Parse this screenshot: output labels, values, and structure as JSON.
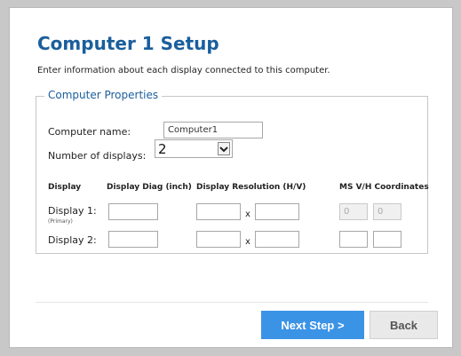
{
  "page": {
    "title": "Computer 1 Setup",
    "subtitle": "Enter information about each display connected to this computer."
  },
  "properties": {
    "legend": "Computer Properties",
    "computer_name_label": "Computer name:",
    "computer_name_value": "Computer1",
    "num_displays_label": "Number of displays:",
    "num_displays_value": "2"
  },
  "table": {
    "headers": {
      "display": "Display",
      "diag": "Display Diag (inch)",
      "resolution": "Display Resolution (H/V)",
      "coords": "MS V/H Coordinates"
    },
    "separator": "x",
    "rows": [
      {
        "label": "Display 1:",
        "sublabel": "(Primary)",
        "diag": "",
        "res_h": "",
        "res_v": "",
        "coord_v": "0",
        "coord_h": "0"
      },
      {
        "label": "Display 2:",
        "diag": "",
        "res_h": "",
        "res_v": "",
        "coord_v": "",
        "coord_h": ""
      }
    ]
  },
  "buttons": {
    "next": "Next Step >",
    "back": "Back"
  },
  "colors": {
    "title": "#1a5e9c",
    "next_button": "#3b93e6",
    "back_button": "#e9e9e9"
  },
  "icons": {
    "dropdown": "chevron-down-icon"
  }
}
